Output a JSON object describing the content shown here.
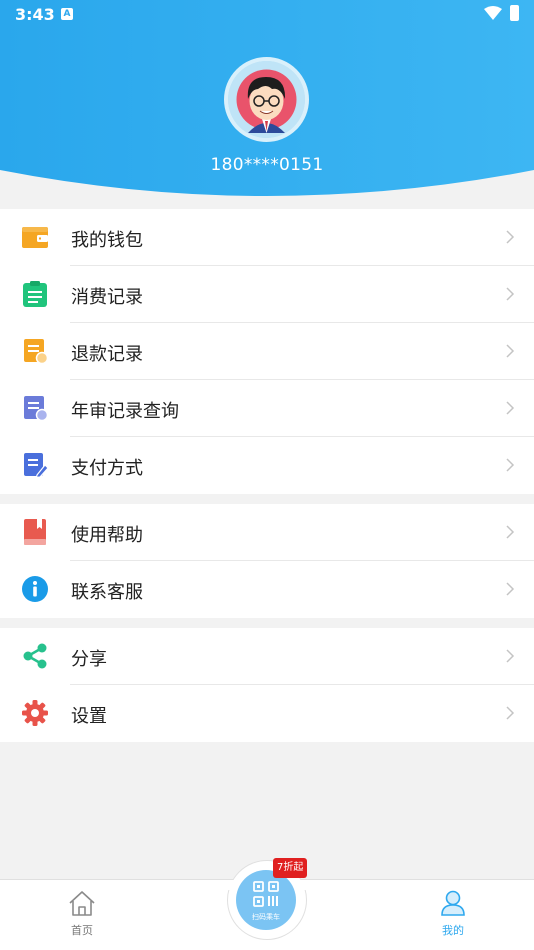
{
  "status": {
    "time": "3:43",
    "a_icon": "A"
  },
  "profile": {
    "phone": "180****0151"
  },
  "menu_groups": [
    [
      {
        "label": "我的钱包",
        "icon": "wallet-icon",
        "color": "#f5a623"
      },
      {
        "label": "消费记录",
        "icon": "clipboard-icon",
        "color": "#20c47c"
      },
      {
        "label": "退款记录",
        "icon": "refund-doc-icon",
        "color": "#f5a623"
      },
      {
        "label": "年审记录查询",
        "icon": "audit-doc-icon",
        "color": "#6b7bd9"
      },
      {
        "label": "支付方式",
        "icon": "edit-doc-icon",
        "color": "#4a6fdc"
      }
    ],
    [
      {
        "label": "使用帮助",
        "icon": "book-icon",
        "color": "#e85a4f"
      },
      {
        "label": "联系客服",
        "icon": "info-icon",
        "color": "#1a9be8"
      }
    ],
    [
      {
        "label": "分享",
        "icon": "share-icon",
        "color": "#27c18d"
      },
      {
        "label": "设置",
        "icon": "gear-icon",
        "color": "#e8534a"
      }
    ]
  ],
  "tabbar": {
    "home_label": "首页",
    "scan_label": "扫码乘车",
    "scan_badge": "7折起",
    "mine_label": "我的",
    "active_color": "#2ea8ee"
  }
}
